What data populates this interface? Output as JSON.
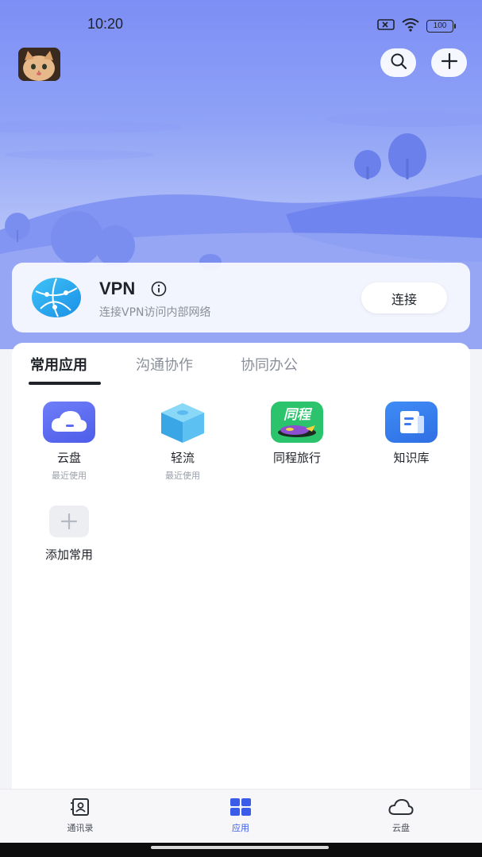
{
  "status_bar": {
    "time": "10:20",
    "battery": "100"
  },
  "header": {
    "avatar_icon": "cat-avatar",
    "search_icon": "search-icon",
    "add_icon": "plus-icon"
  },
  "vpn": {
    "title": "VPN",
    "subtitle": "连接VPN访问内部网络",
    "connect_label": "连接"
  },
  "tabs": [
    {
      "label": "常用应用",
      "active": true
    },
    {
      "label": "沟通协作",
      "active": false
    },
    {
      "label": "协同办公",
      "active": false
    }
  ],
  "apps": [
    {
      "name": "云盘",
      "sub": "最近使用",
      "icon": "cloud-disk-icon"
    },
    {
      "name": "轻流",
      "sub": "最近使用",
      "icon": "qingliu-cube-icon"
    },
    {
      "name": "同程旅行",
      "sub": "",
      "icon": "tongcheng-travel-icon",
      "icon_text": "同程"
    },
    {
      "name": "知识库",
      "sub": "",
      "icon": "knowledge-base-icon"
    }
  ],
  "add_common": {
    "label": "添加常用"
  },
  "bottom_nav": [
    {
      "label": "通讯录",
      "icon": "contacts-icon",
      "active": false
    },
    {
      "label": "应用",
      "icon": "apps-grid-icon",
      "active": true
    },
    {
      "label": "云盘",
      "icon": "cloud-icon",
      "active": false
    }
  ],
  "colors": {
    "accent": "#3a5ce9",
    "hero_top": "#7d8ef5",
    "tongcheng_green": "#2bc36b"
  }
}
